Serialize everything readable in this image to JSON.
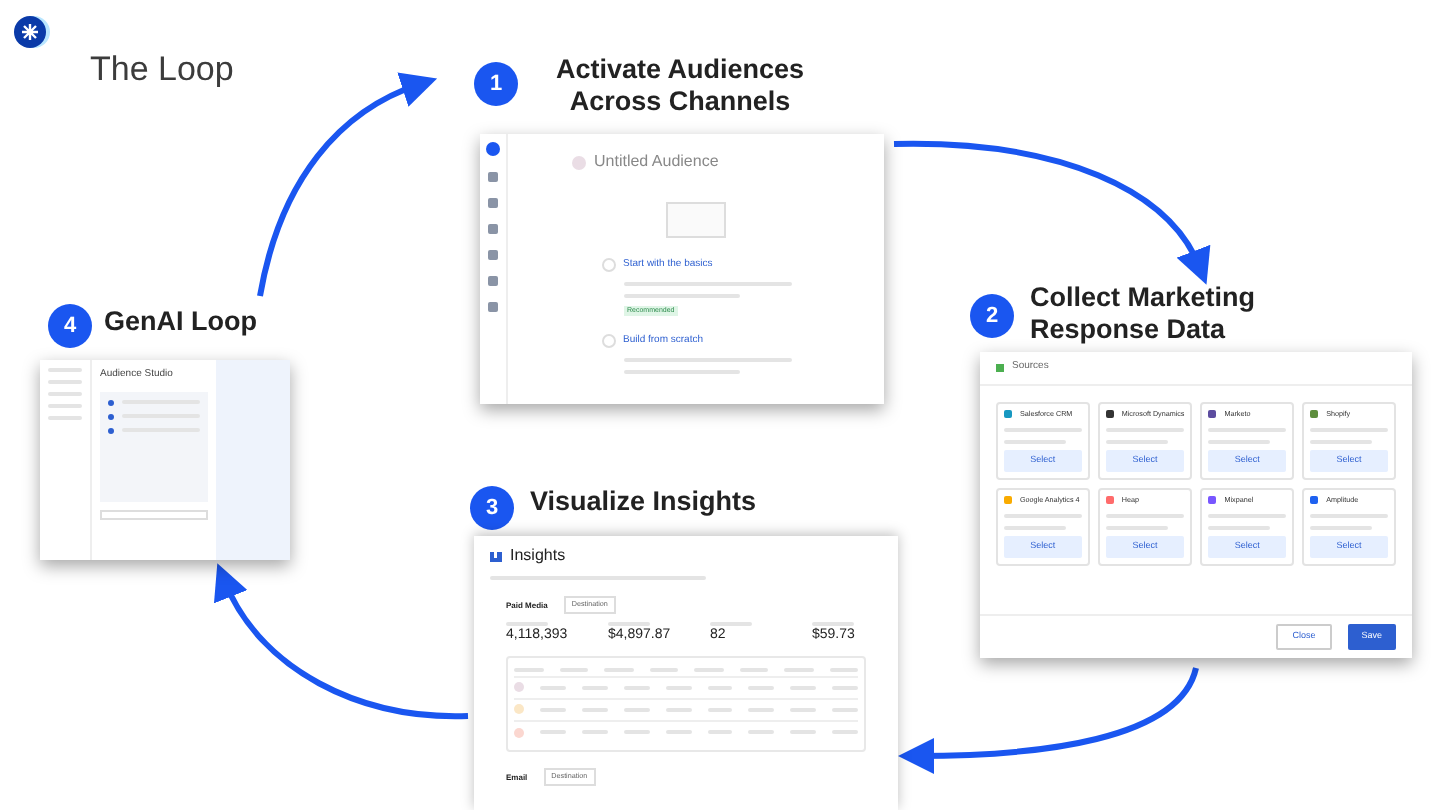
{
  "title": "The Loop",
  "steps": [
    {
      "number": "1",
      "title": "Activate Audiences Across Channels"
    },
    {
      "number": "2",
      "title": "Collect Marketing Response Data"
    },
    {
      "number": "3",
      "title": "Visualize Insights"
    },
    {
      "number": "4",
      "title": "GenAI Loop"
    }
  ],
  "audience_screen": {
    "title": "Untitled Audience",
    "options": [
      {
        "title": "Start with the basics",
        "badge": "Recommended"
      },
      {
        "title": "Build from scratch"
      }
    ]
  },
  "sources_screen": {
    "title": "Sources",
    "sources": [
      {
        "name": "Salesforce CRM",
        "color": "#1798c1",
        "action": "Select"
      },
      {
        "name": "Microsoft Dynamics",
        "color": "#333333",
        "action": "Select"
      },
      {
        "name": "Marketo",
        "color": "#5c4c9f",
        "action": "Select"
      },
      {
        "name": "Shopify",
        "color": "#5e8e3e",
        "action": "Select"
      },
      {
        "name": "Google Analytics 4",
        "color": "#f9ab00",
        "action": "Select"
      },
      {
        "name": "Heap",
        "color": "#ff6b6b",
        "action": "Select"
      },
      {
        "name": "Mixpanel",
        "color": "#7856ff",
        "action": "Select"
      },
      {
        "name": "Amplitude",
        "color": "#1e61f0",
        "action": "Select"
      }
    ],
    "buttons": [
      {
        "label": "Close",
        "kind": "secondary"
      },
      {
        "label": "Save",
        "kind": "primary"
      }
    ]
  },
  "insights_screen": {
    "title": "Insights",
    "sections": [
      {
        "label": "Paid Media",
        "dropdown": "Destination"
      }
    ],
    "metrics": [
      "4,118,393",
      "$4,897.87",
      "82",
      "$59.73"
    ],
    "footer_section": {
      "label": "Email",
      "dropdown": "Destination"
    }
  },
  "genai_screen": {
    "title": "Audience Studio"
  }
}
